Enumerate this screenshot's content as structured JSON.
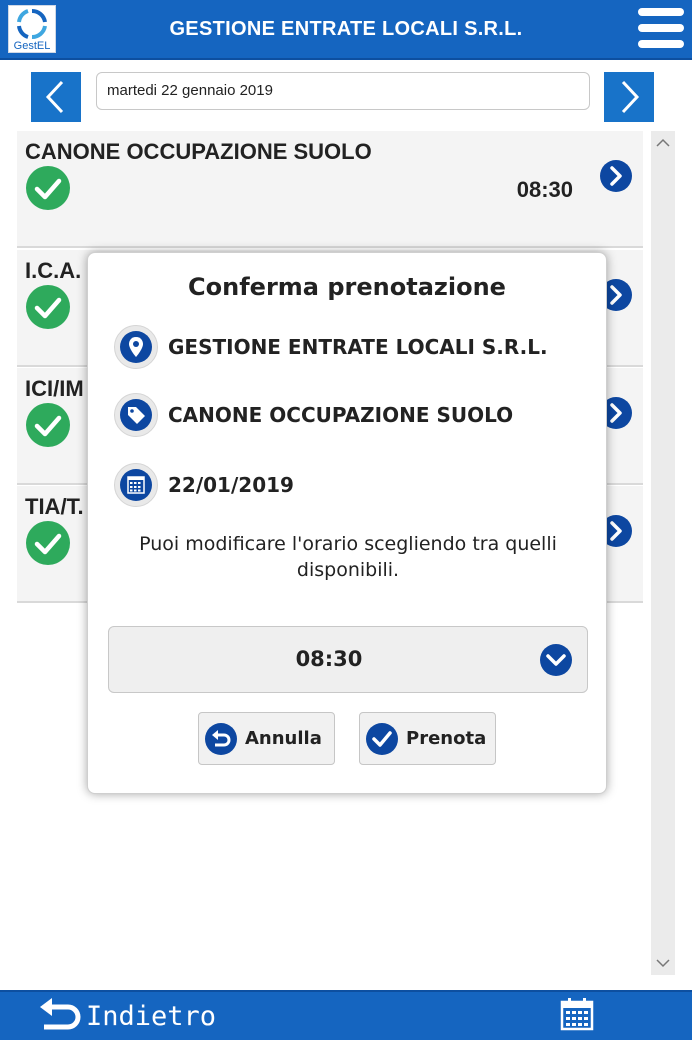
{
  "header": {
    "logo_text": "GestEL",
    "title": "GESTIONE ENTRATE LOCALI S.R.L.",
    "menu_icon": "hamburger-menu-icon"
  },
  "date_bar": {
    "prev_icon": "chevron-left-icon",
    "date": "martedi 22 gennaio 2019",
    "next_icon": "chevron-right-icon"
  },
  "list": {
    "items": [
      {
        "title": "CANONE OCCUPAZIONE SUOLO",
        "time": "08:30"
      },
      {
        "title": "I.C.A.",
        "time": ""
      },
      {
        "title": "ICI/IM",
        "time": ""
      },
      {
        "title": "TIA/T.",
        "time": ""
      }
    ]
  },
  "modal": {
    "title": "Conferma prenotazione",
    "office": "GESTIONE ENTRATE LOCALI S.R.L.",
    "service": "CANONE OCCUPAZIONE SUOLO",
    "date": "22/01/2019",
    "note": "Puoi modificare l'orario scegliendo tra quelli disponibili.",
    "selected_time": "08:30",
    "cancel_label": "Annulla",
    "book_label": "Prenota"
  },
  "footer": {
    "back_label": "Indietro",
    "calendar_icon": "calendar-icon"
  },
  "colors": {
    "brand_blue": "#1565c0",
    "icon_blue": "#0d47a1",
    "check_green": "#2eaa5c"
  }
}
